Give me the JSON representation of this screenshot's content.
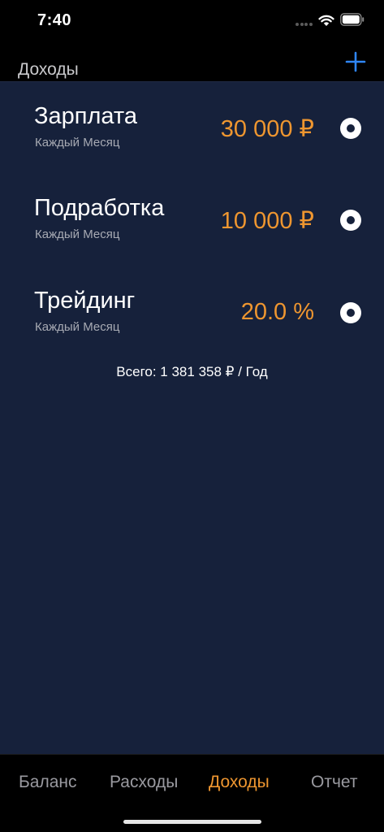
{
  "status_bar": {
    "time": "7:40"
  },
  "nav": {
    "title": "Доходы",
    "add_icon": "plus-icon"
  },
  "colors": {
    "accent": "#ee9630",
    "background": "#16213b",
    "add_button": "#2f86f6"
  },
  "income_items": [
    {
      "name": "Зарплата",
      "period": "Каждый Месяц",
      "amount": "30 000 ₽"
    },
    {
      "name": "Подработка",
      "period": "Каждый Месяц",
      "amount": "10 000 ₽"
    },
    {
      "name": "Трейдинг",
      "period": "Каждый Месяц",
      "amount": "20.0 %"
    }
  ],
  "total": "Всего: 1 381 358 ₽ / Год",
  "tabs": [
    {
      "label": "Баланс",
      "active": false
    },
    {
      "label": "Расходы",
      "active": false
    },
    {
      "label": "Доходы",
      "active": true
    },
    {
      "label": "Отчет",
      "active": false
    }
  ]
}
